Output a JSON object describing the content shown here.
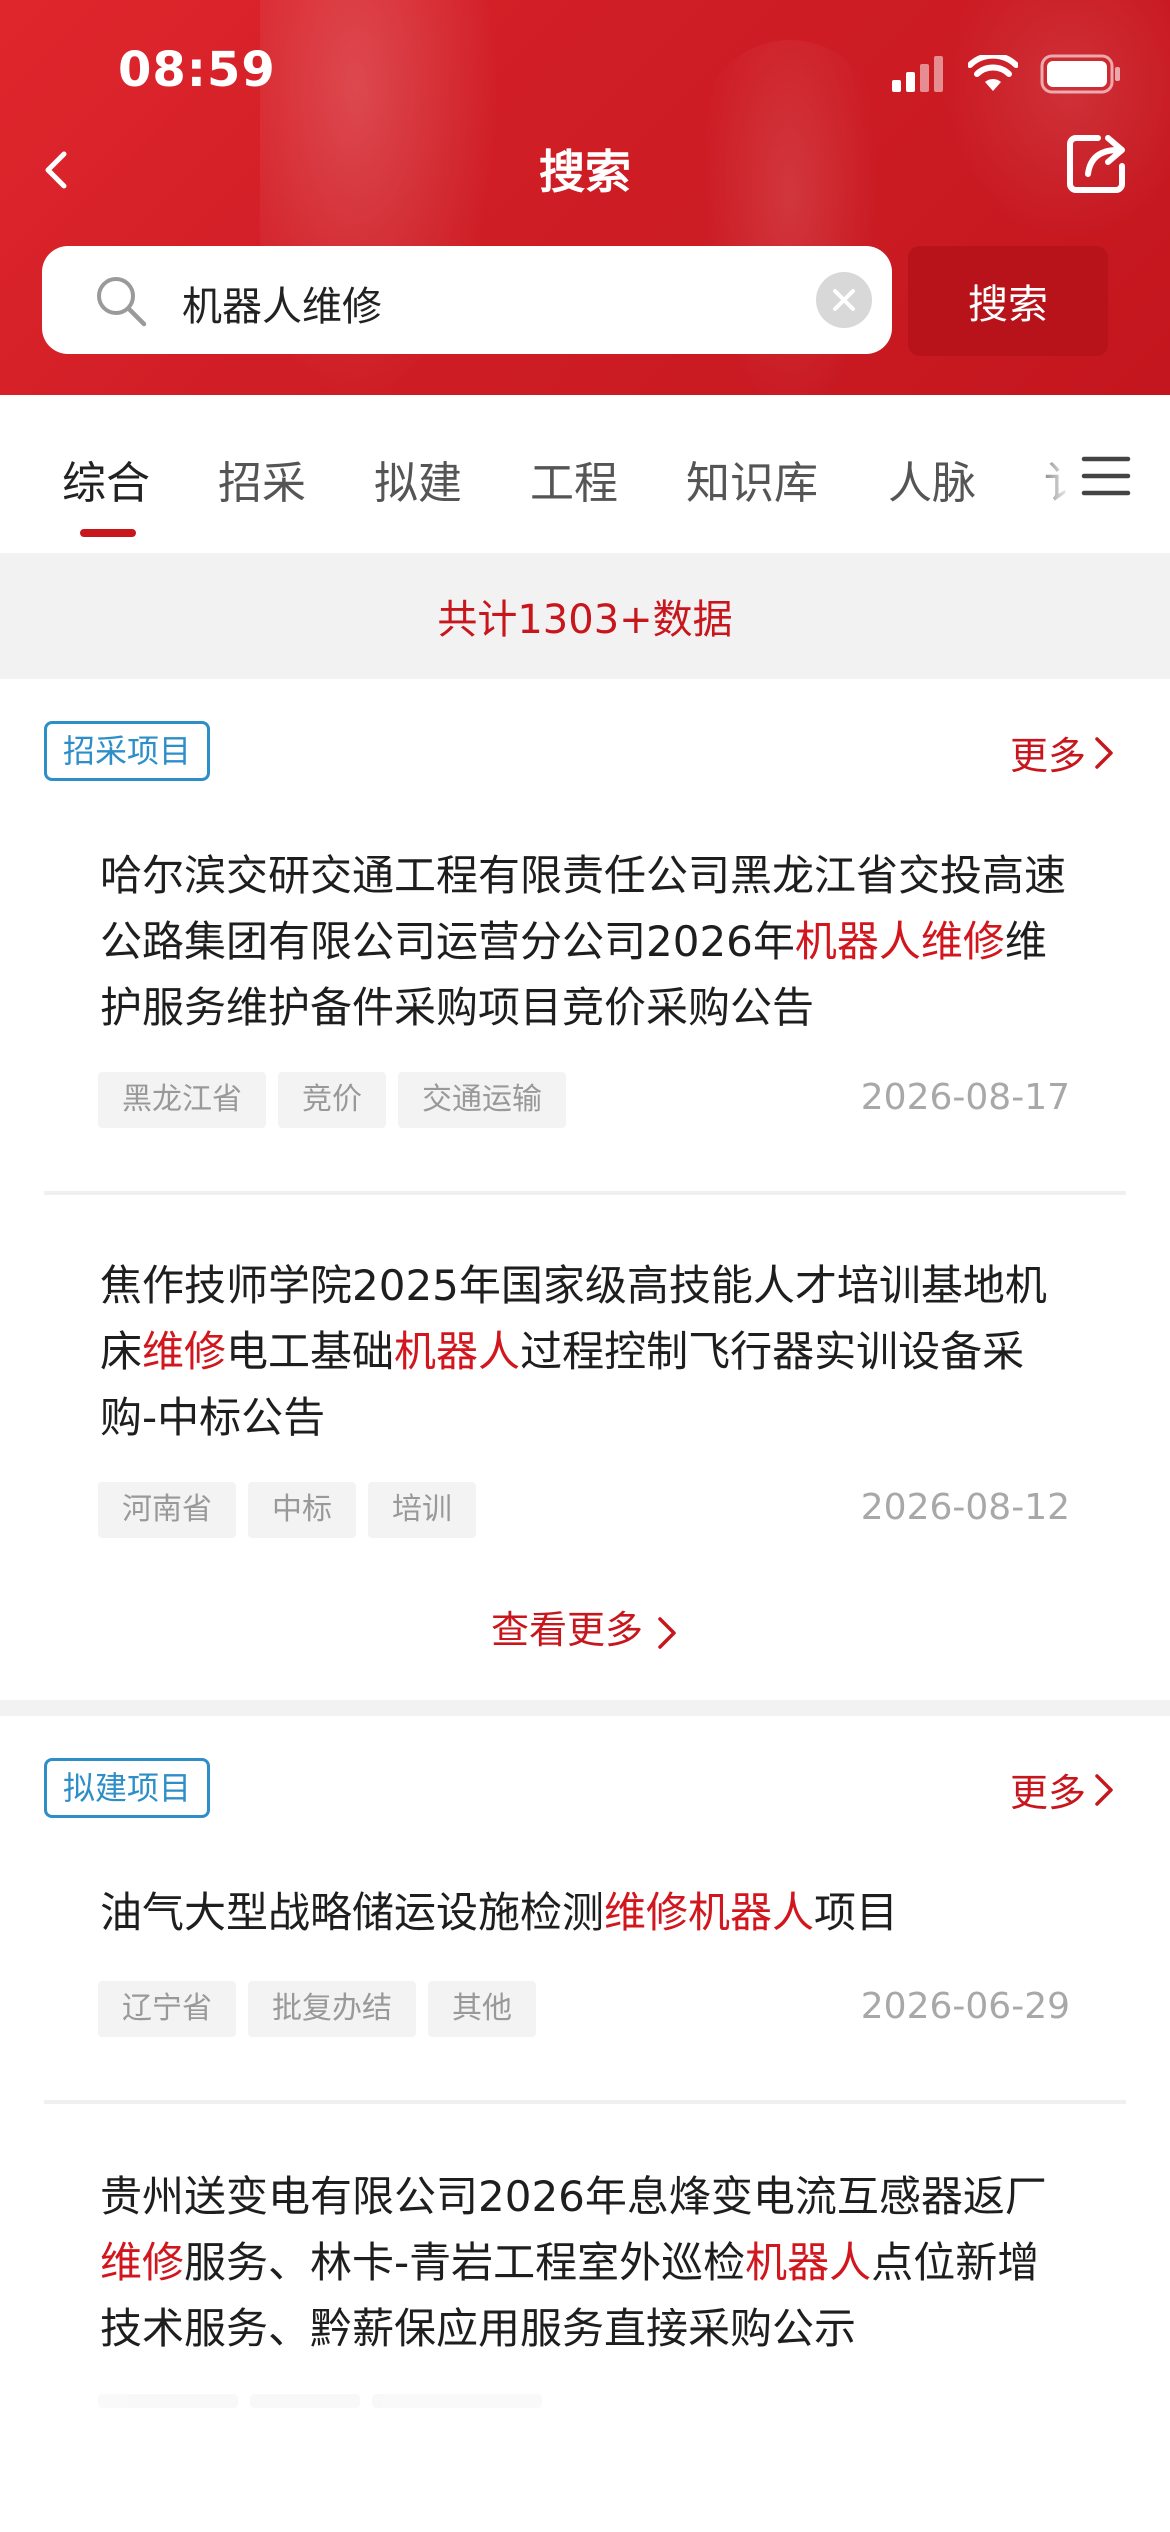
{
  "status": {
    "time": "08:59"
  },
  "nav": {
    "title": "搜索"
  },
  "search": {
    "query": "机器人维修",
    "button_label": "搜索"
  },
  "tabs": [
    {
      "label": "综合",
      "active": true
    },
    {
      "label": "招采"
    },
    {
      "label": "拟建"
    },
    {
      "label": "工程"
    },
    {
      "label": "知识库"
    },
    {
      "label": "人脉"
    },
    {
      "label": "讠"
    }
  ],
  "count_text": "共计1303+数据",
  "colors": {
    "brand_red": "#c8161d",
    "tag_blue": "#2e8ec8",
    "highlight": "#d2161e"
  },
  "sections": [
    {
      "tag": "招采项目",
      "more_label": "更多",
      "see_more_label": "查看更多",
      "items": [
        {
          "title_parts": [
            {
              "text": "哈尔滨交研交通工程有限责任公司黑龙江省交投高速公路集团有限公司运营分公司2026年",
              "hl": false
            },
            {
              "text": "机器人维修",
              "hl": true
            },
            {
              "text": "维护服务维护备件采购项目竞价采购公告",
              "hl": false
            }
          ],
          "tags": [
            "黑龙江省",
            "竞价",
            "交通运输"
          ],
          "date": "2026-08-17"
        },
        {
          "title_parts": [
            {
              "text": "焦作技师学院2025年国家级高技能人才培训基地机床",
              "hl": false
            },
            {
              "text": "维修",
              "hl": true
            },
            {
              "text": "电工基础",
              "hl": false
            },
            {
              "text": "机器人",
              "hl": true
            },
            {
              "text": "过程控制飞行器实训设备采购-中标公告",
              "hl": false
            }
          ],
          "tags": [
            "河南省",
            "中标",
            "培训"
          ],
          "date": "2026-08-12"
        }
      ]
    },
    {
      "tag": "拟建项目",
      "more_label": "更多",
      "items": [
        {
          "title_parts": [
            {
              "text": "油气大型战略储运设施检测",
              "hl": false
            },
            {
              "text": "维修机器人",
              "hl": true
            },
            {
              "text": "项目",
              "hl": false
            }
          ],
          "tags": [
            "辽宁省",
            "批复办结",
            "其他"
          ],
          "date": "2026-06-29"
        },
        {
          "title_parts": [
            {
              "text": "贵州送变电有限公司2026年息烽变电流互感器返厂",
              "hl": false
            },
            {
              "text": "维修",
              "hl": true
            },
            {
              "text": "服务、林卡-青岩工程室外巡检",
              "hl": false
            },
            {
              "text": "机器人",
              "hl": true
            },
            {
              "text": "点位新增技术服务、黔薪保应用服务直接采购公示",
              "hl": false
            }
          ]
        }
      ]
    }
  ]
}
